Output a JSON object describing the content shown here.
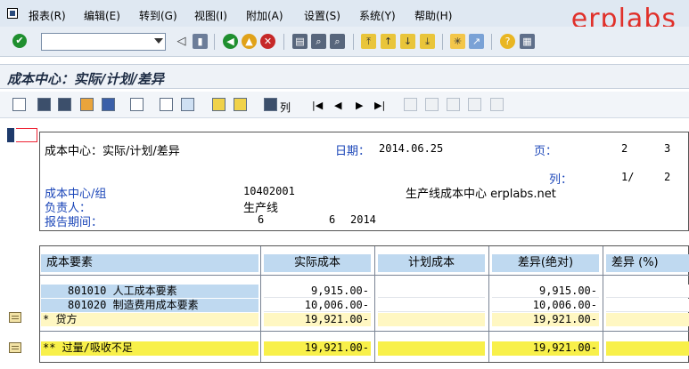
{
  "menu": {
    "items": [
      "报表(R)",
      "编辑(E)",
      "转到(G)",
      "视图(I)",
      "附加(A)",
      "设置(S)",
      "系统(Y)",
      "帮助(H)"
    ]
  },
  "brand": "erplabs",
  "toolbar": {
    "command_value": ""
  },
  "title": "成本中心：实际/计划/差异",
  "app_toolbar": {
    "columns_label": "列"
  },
  "header": {
    "report_name": "成本中心：实际/计划/差异",
    "date_label": "日期：",
    "date_value": "2014.06.25",
    "page_label": "页：",
    "page_value": "2",
    "page_total": "3",
    "column_label": "列：",
    "column_value": "1/",
    "column_total": "2",
    "cost_center_label": "成本中心/组",
    "cost_center_value": "10402001",
    "cost_center_name": "生产线成本中心 erplabs.net",
    "responsible_label": "负责人：",
    "responsible_value": "生产线",
    "period_label": "报告期间：",
    "period_from": "6",
    "period_to": "6",
    "period_year": "2014"
  },
  "table": {
    "columns": [
      "成本要素",
      "实际成本",
      "计划成本",
      "差异(绝对)",
      "差异 (%)"
    ],
    "rows": [
      {
        "element": "801010  人工成本要素",
        "actual": "9,915.00-",
        "plan": "",
        "variance": "9,915.00-",
        "pct": ""
      },
      {
        "element": "801020  制造费用成本要素",
        "actual": "10,006.00-",
        "plan": "",
        "variance": "10,006.00-",
        "pct": ""
      },
      {
        "element": "*  贷方",
        "actual": "19,921.00-",
        "plan": "",
        "variance": "19,921.00-",
        "pct": ""
      }
    ],
    "total": {
      "element": "** 过量/吸收不足",
      "actual": "19,921.00-",
      "plan": "",
      "variance": "19,921.00-",
      "pct": ""
    }
  },
  "colors": {
    "header_cell": "#bfd9f0",
    "subtotal": "#fff7c2",
    "total": "#f8f04a",
    "label_blue": "#1a45b8",
    "brand": "#e0302a"
  },
  "icons": [
    "sap-logo-icon",
    "ok-icon",
    "back-icon",
    "save-icon",
    "exit-icon",
    "cancel-icon",
    "print-icon",
    "find-icon",
    "help-icon",
    "layout-icon"
  ]
}
